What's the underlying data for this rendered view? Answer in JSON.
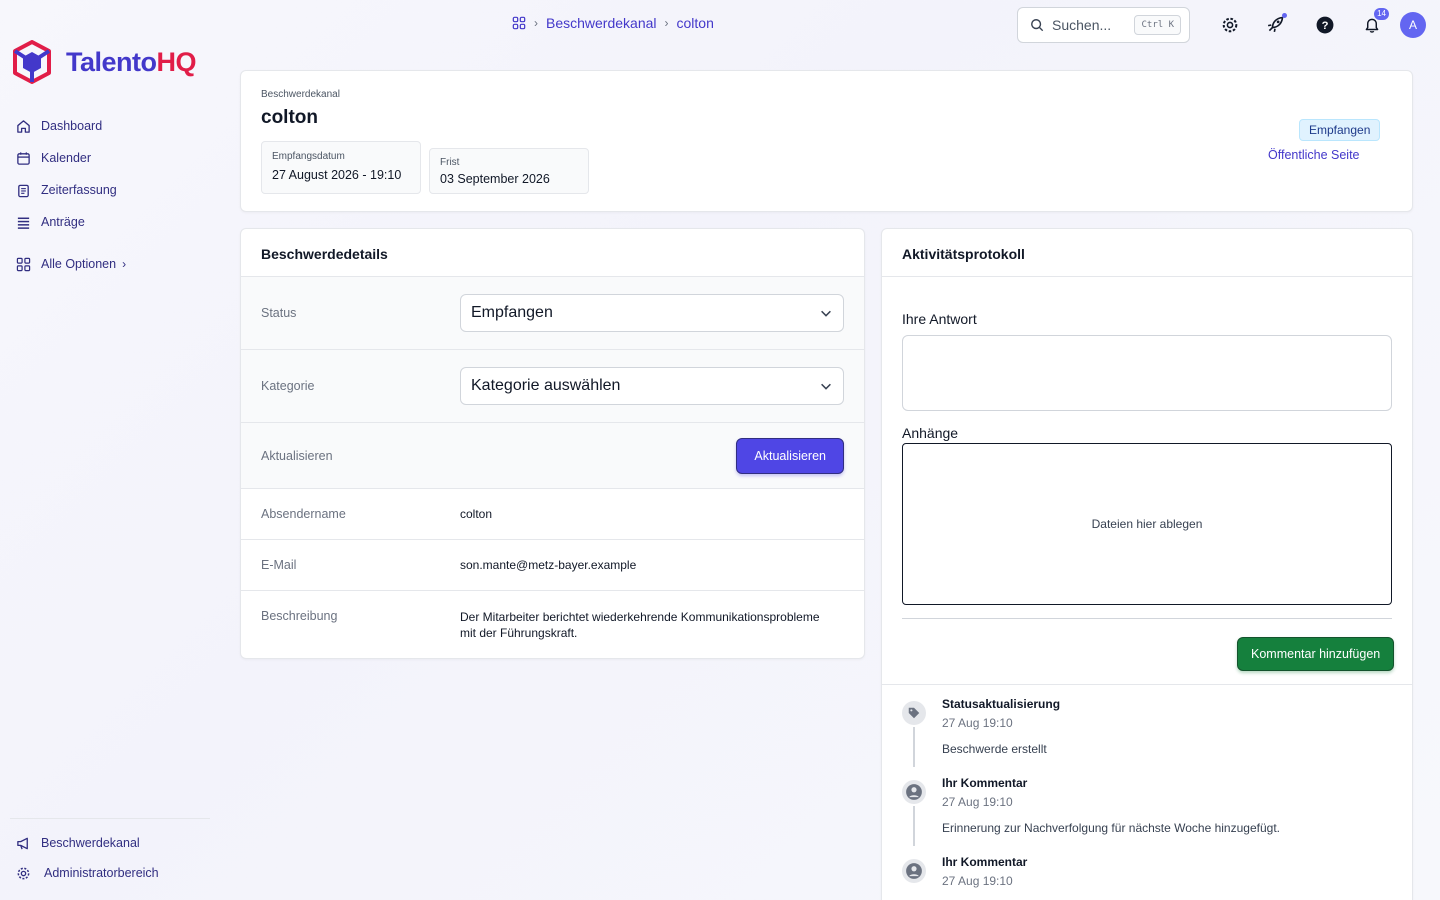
{
  "brand": {
    "name_main": "Talento",
    "name_accent": "HQ"
  },
  "sidebar": {
    "items": [
      {
        "label": "Dashboard",
        "icon": "home-icon"
      },
      {
        "label": "Kalender",
        "icon": "calendar-icon"
      },
      {
        "label": "Zeiterfassung",
        "icon": "clipboard-icon"
      },
      {
        "label": "Anträge",
        "icon": "list-icon"
      }
    ],
    "all_options": "Alle Optionen",
    "bottom_items": [
      {
        "label": "Beschwerdekanal",
        "icon": "megaphone-icon"
      },
      {
        "label": "Administratorbereich",
        "icon": "gear-icon"
      }
    ]
  },
  "breadcrumb": {
    "items": [
      "Beschwerdekanal",
      "colton"
    ]
  },
  "search": {
    "placeholder": "Suchen...",
    "shortcut": "Ctrl K"
  },
  "user": {
    "avatar_initial": "A",
    "notification_count": "14"
  },
  "complaint": {
    "channel": "Beschwerdekanal",
    "title": "colton",
    "received_label": "Empfangsdatum",
    "received_value": "27 August 2026 - 19:10",
    "deadline_label": "Frist",
    "deadline_value": "03 September 2026",
    "status_badge": "Empfangen",
    "public_link": "Öffentliche Seite"
  },
  "details": {
    "heading": "Beschwerdedetails",
    "status_label": "Status",
    "status_value": "Empfangen",
    "category_label": "Kategorie",
    "category_value": "Kategorie auswählen",
    "update_label": "Aktualisieren",
    "update_button": "Aktualisieren",
    "sender_label": "Absendername",
    "sender_value": "colton",
    "email_label": "E-Mail",
    "email_value": "son.mante@metz-bayer.example",
    "description_label": "Beschreibung",
    "description_value": "Der Mitarbeiter berichtet wiederkehrende Kommunikationsprobleme mit der Führungskraft."
  },
  "activity": {
    "heading": "Aktivitätsprotokoll",
    "answer_label": "Ihre Antwort",
    "attachments_label": "Anhänge",
    "dropzone_text": "Dateien hier ablegen",
    "add_comment_button": "Kommentar hinzufügen",
    "entries": [
      {
        "title": "Statusaktualisierung",
        "time": "27 Aug 19:10",
        "text": "Beschwerde erstellt",
        "icon": "tag-icon"
      },
      {
        "title": "Ihr Kommentar",
        "time": "27 Aug 19:10",
        "text": "Erinnerung zur Nachverfolgung für nächste Woche hinzugefügt.",
        "icon": "user-icon"
      },
      {
        "title": "Ihr Kommentar",
        "time": "27 Aug 19:10",
        "text": "",
        "icon": "user-icon"
      }
    ]
  },
  "colors": {
    "primary": "#4f46e5",
    "success": "#15803d",
    "brand_accent": "#e11d48"
  }
}
